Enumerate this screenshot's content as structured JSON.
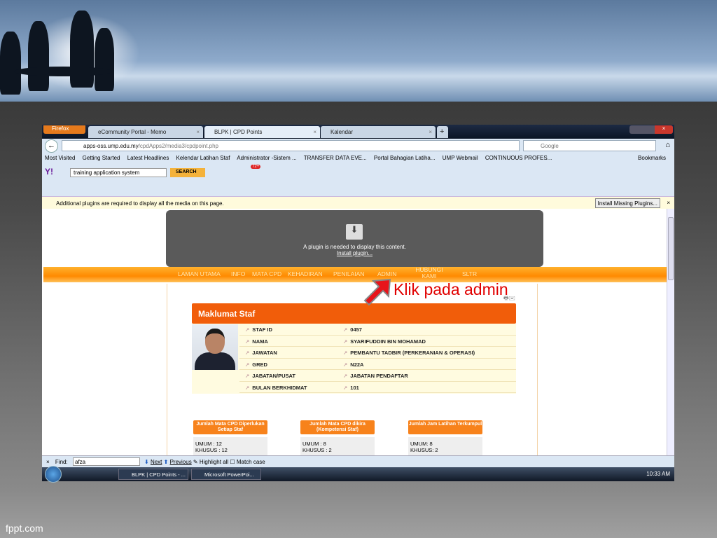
{
  "browser": {
    "menu_button": "Firefox",
    "tabs": [
      {
        "label": "eCommunity Portal - Memo"
      },
      {
        "label": "BLPK | CPD Points"
      },
      {
        "label": "Kalendar"
      }
    ],
    "url_host": "apps-oss.ump.edu.my",
    "url_path": "/cpdApps2/media3/cpdpoint.php",
    "search_placeholder": "Google",
    "bookmarks": [
      "Most Visited",
      "Getting Started",
      "Latest Headlines",
      "Kelendar Latihan Staf",
      "Administrator -Sistem ...",
      "TRANSFER DATA EVE...",
      "Portal Bahagian Latiha...",
      "UMP Webmail",
      "CONTINUOUS PROFES..."
    ],
    "bookmarks_menu": "Bookmarks",
    "yahoo_search_value": "training application system",
    "yahoo_search_button": "SEARCH",
    "mail_badge": "72+",
    "notification": "Additional plugins are required to display all the media on this page.",
    "install_button": "Install Missing Plugins...",
    "find_label": "Find:",
    "find_value": "afza",
    "find_next": "Next",
    "find_previous": "Previous",
    "find_highlight": "Highlight all",
    "find_match_case": "Match case"
  },
  "page": {
    "plugin_message": "A plugin is needed to display this content.",
    "plugin_link": "Install plugin...",
    "nav": [
      "LAMAN UTAMA",
      "INFO",
      "MATA CPD",
      "KEHADIRAN",
      "PENILAIAN",
      "ADMIN",
      "HUBUNGI KAMI",
      "SLTR"
    ],
    "annotation": "Klik pada admin",
    "panel_title": "Maklumat Staf",
    "rows": [
      {
        "k": "STAF ID",
        "v": "0457"
      },
      {
        "k": "NAMA",
        "v": "SYARIFUDDIN BIN MOHAMAD"
      },
      {
        "k": "JAWATAN",
        "v": "PEMBANTU TADBIR (PERKERANIAN & OPERASI)"
      },
      {
        "k": "GRED",
        "v": "N22A"
      },
      {
        "k": "JABATAN/PUSAT",
        "v": "JABATAN PENDAFTAR"
      },
      {
        "k": "BULAN BERKHIDMAT",
        "v": "101"
      }
    ],
    "boxes": [
      {
        "title": "Jumlah Mata CPD Diperlukan Setiap Staf",
        "l1": "UMUM : 12",
        "l2": "KHUSUS : 12"
      },
      {
        "title": "Jumlah Mata CPD dikira (Kompetensi Staf)",
        "l1": "UMUM : 8",
        "l2": "KHUSUS : 2"
      },
      {
        "title": "Jumlah Jam Latihan Terkumpul",
        "l1": "UMUM: 8",
        "l2": "KHUSUS: 2"
      }
    ]
  },
  "taskbar": {
    "items": [
      "BLPK | CPD Points - ...",
      "Microsoft PowerPoi..."
    ],
    "clock": "10:33 AM"
  },
  "slide_footer": "fppt.com",
  "colors": {
    "accent": "#f15d0a",
    "annotation": "#e10000"
  }
}
